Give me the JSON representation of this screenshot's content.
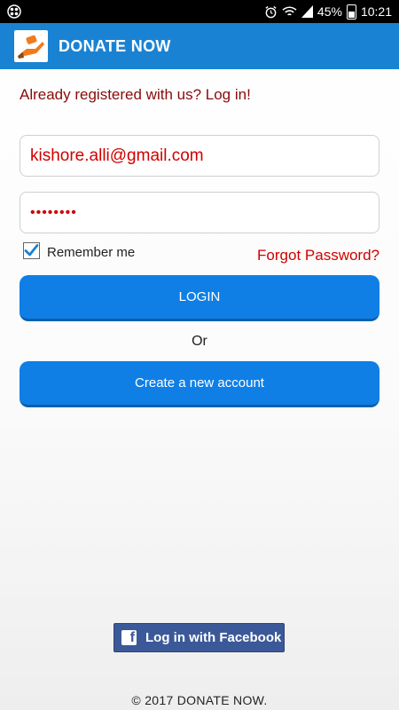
{
  "status_bar": {
    "battery": "45%",
    "time": "10:21",
    "icons": [
      "app-notification-icon",
      "alarm-icon",
      "wifi-icon",
      "signal-icon",
      "battery-icon"
    ]
  },
  "app_bar": {
    "title": "DONATE NOW",
    "logo_icon": "hand-heart-icon",
    "color": "#1a82d2"
  },
  "login": {
    "heading": "Already registered with us? Log in!",
    "email_value": "kishore.alli@gmail.com",
    "password_value": "••••••••",
    "remember_me_label": "Remember me",
    "remember_me_checked": true,
    "forgot_password": "Forgot Password?",
    "login_button": "LOGIN",
    "or_label": "Or",
    "create_account_button": "Create a new account"
  },
  "facebook": {
    "label": "Log in with Facebook",
    "color": "#3b5998"
  },
  "footer": {
    "copyright": "© 2017 DONATE NOW."
  },
  "colors": {
    "heading_text": "#8b0a0a",
    "input_text": "#d00000",
    "button": "#0f7fe6"
  }
}
